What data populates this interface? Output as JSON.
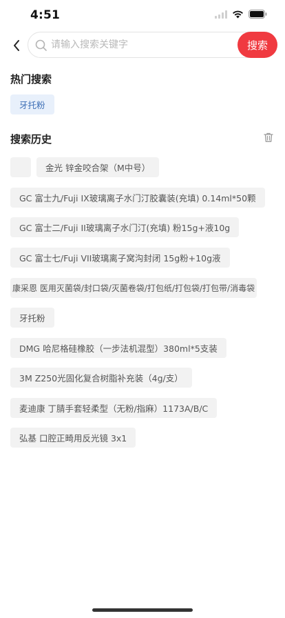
{
  "status_bar": {
    "time": "4:51"
  },
  "search": {
    "placeholder": "请输入搜索关键字",
    "button_label": "搜索"
  },
  "hot": {
    "title": "热门搜索",
    "items": [
      "牙托粉"
    ]
  },
  "history": {
    "title": "搜索历史",
    "items": [
      "",
      "金光 锌金咬合架（M中号）",
      "GC 富士九/Fuji IX玻璃离子水门汀胶囊装(充填) 0.14ml*50颗",
      "GC 富士二/Fuji II玻璃离子水门汀(充填) 粉15g+液10g",
      "GC 富士七/Fuji VII玻璃离子窝沟封闭 15g粉+10g液",
      "康采恩 医用灭菌袋/封口袋/灭菌卷袋/打包纸/打包袋/打包带/消毒袋",
      "牙托粉",
      "DMG 哈尼格硅橡胶（一步法机混型）380ml*5支装",
      "3M Z250光固化复合树脂补充装（4g/支）",
      "麦迪康 丁腈手套轻柔型（无粉/指麻）1173A/B/C",
      "弘基 口腔正畸用反光镜 3x1"
    ]
  },
  "colors": {
    "accent": "#f03a40",
    "hot_tag_bg": "#e8f0fb",
    "hot_tag_text": "#3e6fb6",
    "history_tag_bg": "#f2f2f2"
  },
  "icons": {
    "back": "chevron-left-icon",
    "search": "search-icon",
    "trash": "trash-icon",
    "wifi": "wifi-icon",
    "battery": "battery-icon",
    "signal": "signal-icon"
  }
}
